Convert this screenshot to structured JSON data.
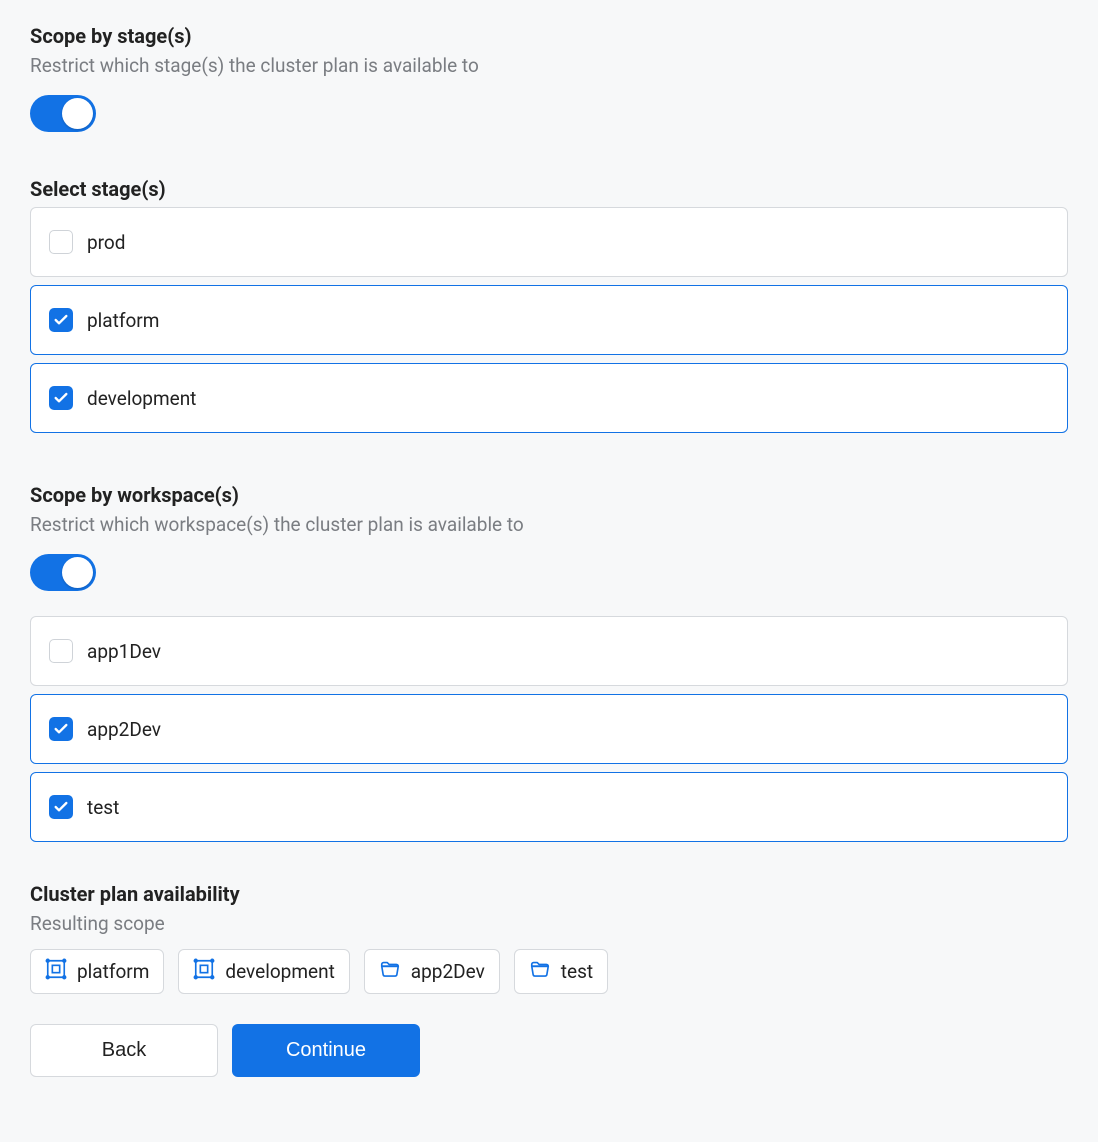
{
  "scope_stages": {
    "title": "Scope by stage(s)",
    "desc": "Restrict which stage(s) the cluster plan is available to",
    "toggle_on": true
  },
  "select_stages": {
    "title": "Select stage(s)",
    "items": [
      {
        "label": "prod",
        "checked": false
      },
      {
        "label": "platform",
        "checked": true
      },
      {
        "label": "development",
        "checked": true
      }
    ]
  },
  "scope_workspaces": {
    "title": "Scope by workspace(s)",
    "desc": "Restrict which workspace(s) the cluster plan is available to",
    "toggle_on": true
  },
  "select_workspaces": {
    "items": [
      {
        "label": "app1Dev",
        "checked": false
      },
      {
        "label": "app2Dev",
        "checked": true
      },
      {
        "label": "test",
        "checked": true
      }
    ]
  },
  "availability": {
    "title": "Cluster plan availability",
    "sub": "Resulting scope",
    "tags": [
      {
        "label": "platform",
        "icon": "stage"
      },
      {
        "label": "development",
        "icon": "stage"
      },
      {
        "label": "app2Dev",
        "icon": "folder"
      },
      {
        "label": "test",
        "icon": "folder"
      }
    ]
  },
  "buttons": {
    "back": "Back",
    "continue": "Continue"
  }
}
